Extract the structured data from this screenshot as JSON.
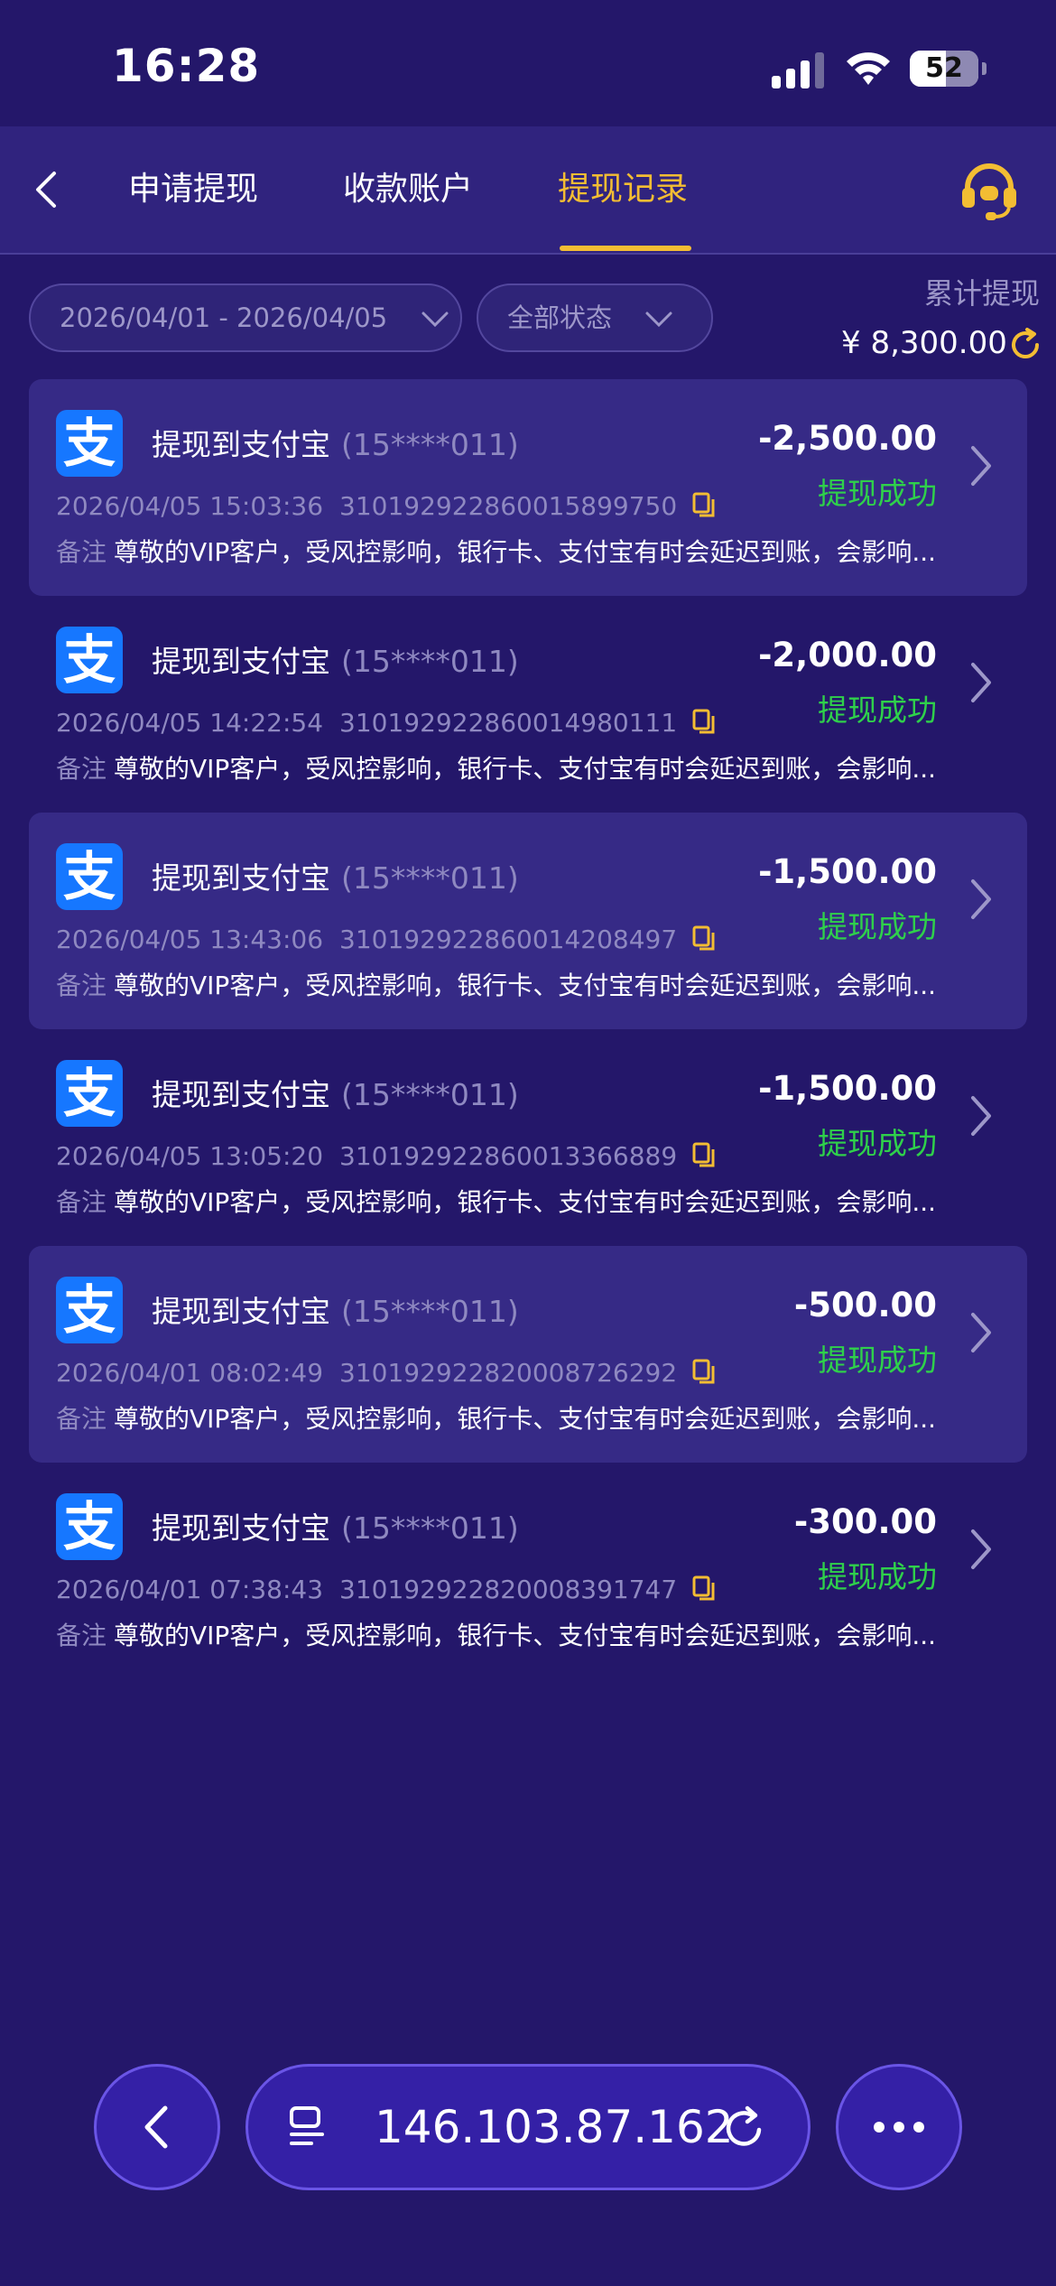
{
  "status_bar": {
    "time": "16:28",
    "battery_percent": "52",
    "battery_level": 0.52
  },
  "header": {
    "tabs": [
      {
        "label": "申请提现",
        "active": false
      },
      {
        "label": "收款账户",
        "active": false
      },
      {
        "label": "提现记录",
        "active": true
      }
    ],
    "accent_color": "#f3bd33"
  },
  "filters": {
    "date_range": "2026/04/01 - 2026/04/05",
    "status": "全部状态"
  },
  "total": {
    "label": "累计提现",
    "amount": "¥ 8,300.00"
  },
  "records": [
    {
      "title": "提现到支付宝",
      "account": "(15****011)",
      "amount": "-2,500.00",
      "status": "提现成功",
      "time": "2026/04/05 15:03:36",
      "order_no": "310192922860015899750",
      "note_label": "备注",
      "note": "尊敬的VIP客户，受风控影响，银行卡、支付宝有时会延迟到账，会影响..."
    },
    {
      "title": "提现到支付宝",
      "account": "(15****011)",
      "amount": "-2,000.00",
      "status": "提现成功",
      "time": "2026/04/05 14:22:54",
      "order_no": "310192922860014980111",
      "note_label": "备注",
      "note": "尊敬的VIP客户，受风控影响，银行卡、支付宝有时会延迟到账，会影响..."
    },
    {
      "title": "提现到支付宝",
      "account": "(15****011)",
      "amount": "-1,500.00",
      "status": "提现成功",
      "time": "2026/04/05 13:43:06",
      "order_no": "310192922860014208497",
      "note_label": "备注",
      "note": "尊敬的VIP客户，受风控影响，银行卡、支付宝有时会延迟到账，会影响..."
    },
    {
      "title": "提现到支付宝",
      "account": "(15****011)",
      "amount": "-1,500.00",
      "status": "提现成功",
      "time": "2026/04/05 13:05:20",
      "order_no": "310192922860013366889",
      "note_label": "备注",
      "note": "尊敬的VIP客户，受风控影响，银行卡、支付宝有时会延迟到账，会影响..."
    },
    {
      "title": "提现到支付宝",
      "account": "(15****011)",
      "amount": "-500.00",
      "status": "提现成功",
      "time": "2026/04/01 08:02:49",
      "order_no": "310192922820008726292",
      "note_label": "备注",
      "note": "尊敬的VIP客户，受风控影响，银行卡、支付宝有时会延迟到账，会影响..."
    },
    {
      "title": "提现到支付宝",
      "account": "(15****011)",
      "amount": "-300.00",
      "status": "提现成功",
      "time": "2026/04/01 07:38:43",
      "order_no": "310192922820008391747",
      "note_label": "备注",
      "note": "尊敬的VIP客户，受风控影响，银行卡、支付宝有时会延迟到账，会影响..."
    }
  ],
  "alipay_logo_char": "支",
  "browser_bar": {
    "url": "146.103.87.162"
  },
  "colors": {
    "background": "#24176a",
    "success": "#2fd04b",
    "alipay": "#1677ff"
  }
}
